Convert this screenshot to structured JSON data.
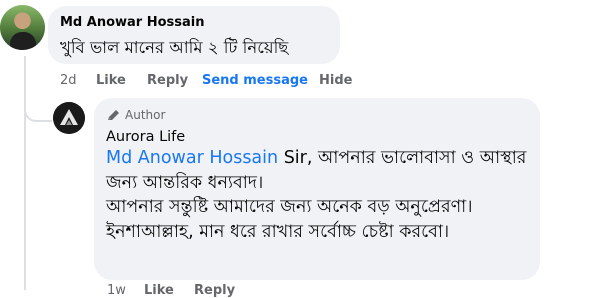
{
  "comment": {
    "author": "Md Anowar Hossain",
    "text": "খুবি ভাল মানের আমি ২ টি নিয়েছি",
    "time": "2d",
    "actions": {
      "like": "Like",
      "reply": "Reply",
      "send_message": "Send message",
      "hide": "Hide"
    }
  },
  "reply": {
    "badge": "Author",
    "author": "Aurora Life",
    "mention": "Md Anowar Hossain",
    "text_after_mention": " Sir, আপনার ভালোবাসা ও আস্থার জন্য আন্তরিক ধন্যবাদ।",
    "text_line2": "আপনার সন্তুষ্টি আমাদের জন্য অনেক বড় অনুপ্রেরণা। ইনশাআল্লাহ, মান ধরে রাখার সর্বোচ্চ চেষ্টা করবো।",
    "actions": {
      "time": "1w",
      "like": "Like",
      "reply": "Reply"
    }
  },
  "colors": {
    "bubble": "#f0f2f5",
    "link": "#1877f2",
    "secondary_text": "#65676b"
  }
}
